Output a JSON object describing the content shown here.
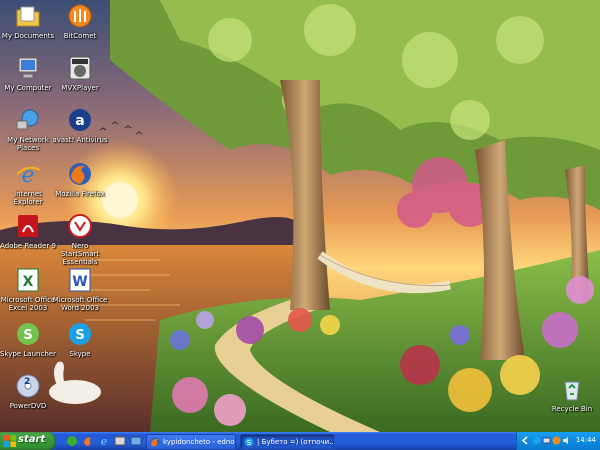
{
  "desktop": {
    "icons_left": [
      {
        "name": "my-documents",
        "label": "My Documents"
      },
      {
        "name": "my-computer",
        "label": "My Computer"
      },
      {
        "name": "my-network-places",
        "label": "My Network Places"
      },
      {
        "name": "internet-explorer",
        "label": "Internet Explorer"
      },
      {
        "name": "adobe-reader",
        "label": "Adobe Reader 9"
      },
      {
        "name": "excel",
        "label": "Microsoft Office Excel 2003"
      },
      {
        "name": "skype-launcher",
        "label": "Skype Launcher"
      },
      {
        "name": "powerdvd",
        "label": "PowerDVD"
      }
    ],
    "icons_right": [
      {
        "name": "bitcomet",
        "label": "BitComet"
      },
      {
        "name": "mvxplayer",
        "label": "MVXPlayer"
      },
      {
        "name": "avast",
        "label": "avast! Antivirus"
      },
      {
        "name": "firefox",
        "label": "Mozilla Firefox"
      },
      {
        "name": "nero",
        "label": "Nero StartSmart Essentials"
      },
      {
        "name": "word",
        "label": "Microsoft Office Word 2003"
      },
      {
        "name": "skype",
        "label": "Skype"
      }
    ],
    "recycle_bin": {
      "label": "Recycle Bin"
    }
  },
  "taskbar": {
    "start_label": "start",
    "tasks": [
      {
        "label": "kypidoncheto - edno2..."
      },
      {
        "label": "| Бубето =) (отпочи..."
      }
    ],
    "clock": "14:44"
  },
  "colors": {
    "taskbar_blue": "#245edb",
    "start_green": "#3c9c3c",
    "tray_blue": "#0d8ae0"
  }
}
